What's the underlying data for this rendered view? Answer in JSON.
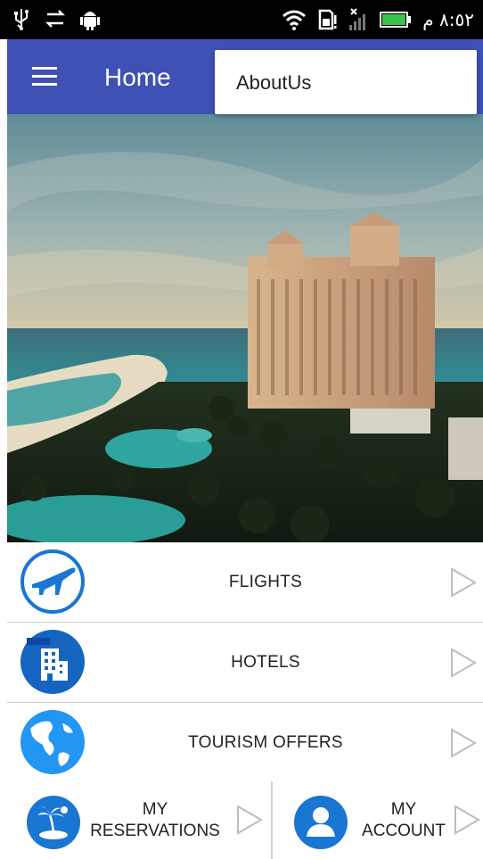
{
  "status_bar": {
    "time": "٨:٥٢ م",
    "icons": [
      "usb-icon",
      "sync-icon",
      "android-debug-icon",
      "wifi-icon",
      "sd-card-icon",
      "signal-icon",
      "battery-icon"
    ]
  },
  "app_bar": {
    "title": "Home",
    "color": "#3f51b5",
    "menu_icon": "hamburger-menu-icon"
  },
  "overflow_menu": {
    "items": [
      {
        "label": "AboutUs"
      }
    ]
  },
  "hero": {
    "image": "resort-hotel-beach-photo"
  },
  "menu": {
    "items": [
      {
        "label": "FLIGHTS",
        "icon": "airplane-icon"
      },
      {
        "label": "HOTELS",
        "icon": "hotel-building-icon"
      },
      {
        "label": "TOURISM OFFERS",
        "icon": "globe-icon"
      }
    ],
    "bottom": [
      {
        "label_line1": "MY",
        "label_line2": "RESERVATIONS",
        "icon": "island-icon"
      },
      {
        "label_line1": "MY",
        "label_line2": "ACCOUNT",
        "icon": "user-icon"
      }
    ],
    "accent_color": "#1976d2",
    "arrow_icon": "chevron-right-outline-icon"
  }
}
